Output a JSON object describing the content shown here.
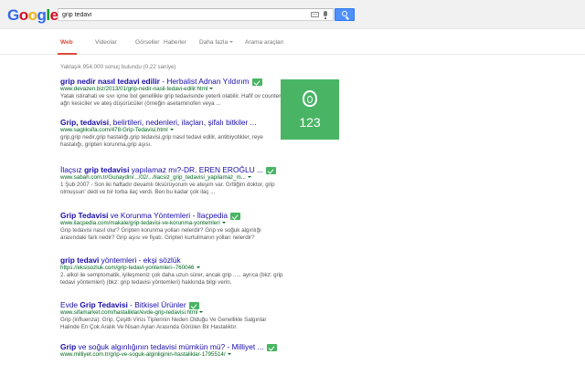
{
  "header": {
    "logo": [
      "G",
      "o",
      "o",
      "g",
      "l",
      "e"
    ],
    "logo_colors": [
      "#3369e8",
      "#d50f25",
      "#eeb211",
      "#3369e8",
      "#009925",
      "#d50f25"
    ],
    "query": "grip tedavi"
  },
  "tabs": [
    {
      "label": "Web",
      "active": true
    },
    {
      "label": "Videolar"
    },
    {
      "label": "Görseller"
    },
    {
      "label": "Haberler"
    },
    {
      "label": "Daha fazla"
    },
    {
      "label": "Arama araçları"
    }
  ],
  "stats": "Yaklaşık 954.000 sonuç bulundu (0,22 saniye)",
  "results": [
    {
      "title_parts": [
        "",
        "grip nedir nasıl tedavi edilir",
        " - Herbalist Adnan Yıldırım"
      ],
      "url": "www.devazen.biz/2013/01/grip-nedir-nasil-tedavi-edilir.html",
      "snippet": "Yatak istirahati ve sıvı içme bol genellikle grip tedavisinde yeterli olabilir. Hafif ov counter ağrı kesiciler ve ateş düşürücüler (örneğin asetaminofen veya ..."
    },
    {
      "title_parts": [
        "",
        "Grip, tedavisi",
        ", belirtileri, nedenleri, ilaçları, şifalı bitkiler ..."
      ],
      "url": "www.saglıksifa.com/478-Grip-Tedavisi.html",
      "snippet": "grip,grip nedir,grip hastalığı,grip tedavisi,grip nasıl tedavi edilir, antibiyotikler, reye hastalığı, gripten korunma,grip aşısı."
    },
    {
      "title_parts": [
        "İlaçsız ",
        "grip tedavisi",
        " yapılamaz mı?-DR. EREN EROĞLU ..."
      ],
      "url": "www.sabah.com.tr/Gunaydin/.../02/.../ilacsiz_grip_tedavisi_yapilamaz_m...",
      "snippet": "1 Şub 2007 - Son iki haftadır devamlı öksürüyorum ve ateşim var. Grtliğim doktor, grip olmuşsun' dedi ve bir torba ilaç verdi. Ben bu kadar çok ilaç ..."
    },
    {
      "title_parts": [
        "",
        "Grip Tedavisi",
        " ve Korunma Yöntemleri - İlaçpedia"
      ],
      "url": "www.ilacpedia.com/makale/grip-tedavisi-ve-korunma-yontemleri",
      "snippet": "Grip tedavisi nasıl olur? Gripten korunma yolları nelerdir? Grip ve soğuk algınlığı arasındaki fark nedir? Grip aşısı ve fiyatı. Gripten kurtulmanın yolları nelerdir?"
    },
    {
      "title_parts": [
        "",
        "grip tedavi",
        " yöntemleri - ekşi sözlük"
      ],
      "url": "https://eksisozluk.com/grip-tedavi-yontemleri--760046",
      "snippet": "2. alkol ile semptomatik, iyileşmeniz çok daha uzun sürer, ancak grip ..... ayrıca (bkz: grip tedavi yöntemleri) (bkz: grip tedavisi yöntemleri) hakkında bilgi verin."
    },
    {
      "title_parts": [
        "Evde ",
        "Grip Tedavisi",
        " - Bitkisel Ürünler"
      ],
      "url": "www.sifamarket.com/hastaliklar/evde-grip-tedavisi.html",
      "snippet": "Grip (influenza): Grip, Çeşitli Virüs Tiplerinin Neden Olduğu Ve Genellikle Salgınlar Halinde En Çok Aralık Ve Nisan Ayları Arasında Görülen Bir Hastalıktır."
    },
    {
      "title_parts": [
        "",
        "Grip",
        " ve soğuk algınlığının tedavisi mümkün mü? - Milliyet ..."
      ],
      "url": "www.milliyet.com.tr/grip-ve-soguk-alginliginin-hastaliklar-1795514/",
      "snippet": ""
    }
  ],
  "card": {
    "icon": "footprint-icon",
    "count": "123",
    "color": "#49b564"
  }
}
